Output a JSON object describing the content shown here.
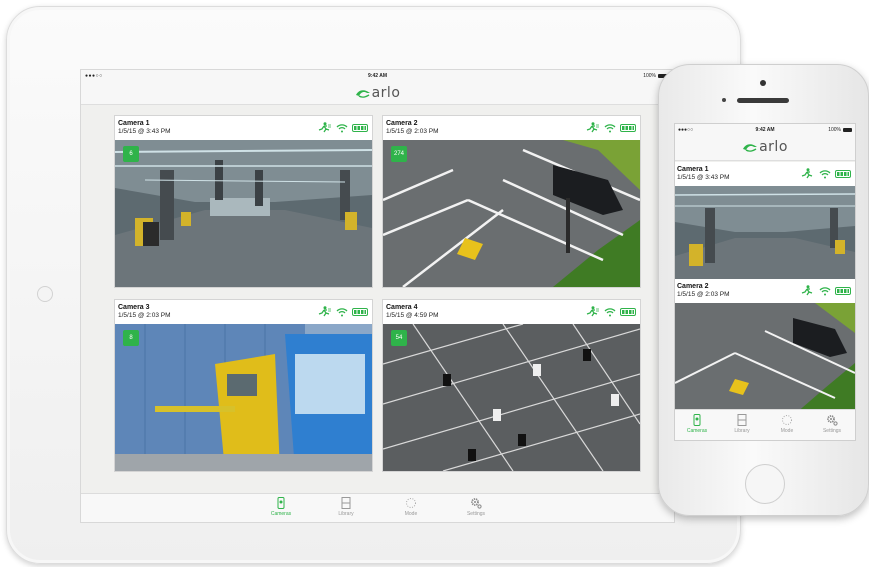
{
  "status_bar": {
    "ipad": {
      "signal": "●●●○○ ",
      "time": "9:42 AM",
      "battery": "100%"
    },
    "iphone": {
      "signal": "●●●○○ ",
      "time": "9:42 AM",
      "battery": "100%"
    }
  },
  "app": {
    "logo": "arlo"
  },
  "colors": {
    "accent": "#2fb34a",
    "badge": "#2fb34a"
  },
  "cameras": [
    {
      "name": "Camera 1",
      "timestamp": "1/5/15 @ 3:43 PM",
      "badge": "6",
      "scene": "garage"
    },
    {
      "name": "Camera 2",
      "timestamp": "1/5/15 @ 2:03 PM",
      "badge": "274",
      "scene": "parking-car"
    },
    {
      "name": "Camera 3",
      "timestamp": "1/5/15 @ 2:03 PM",
      "badge": "8",
      "scene": "toll-booth"
    },
    {
      "name": "Camera 4",
      "timestamp": "1/5/15 @ 4:59 PM",
      "badge": "54",
      "scene": "aerial-lot"
    }
  ],
  "tabs": [
    {
      "label": "Cameras",
      "icon": "camera-icon",
      "active": true
    },
    {
      "label": "Library",
      "icon": "film-icon",
      "active": false
    },
    {
      "label": "Mode",
      "icon": "mode-icon",
      "active": false
    },
    {
      "label": "Settings",
      "icon": "gear-icon",
      "active": false
    }
  ]
}
